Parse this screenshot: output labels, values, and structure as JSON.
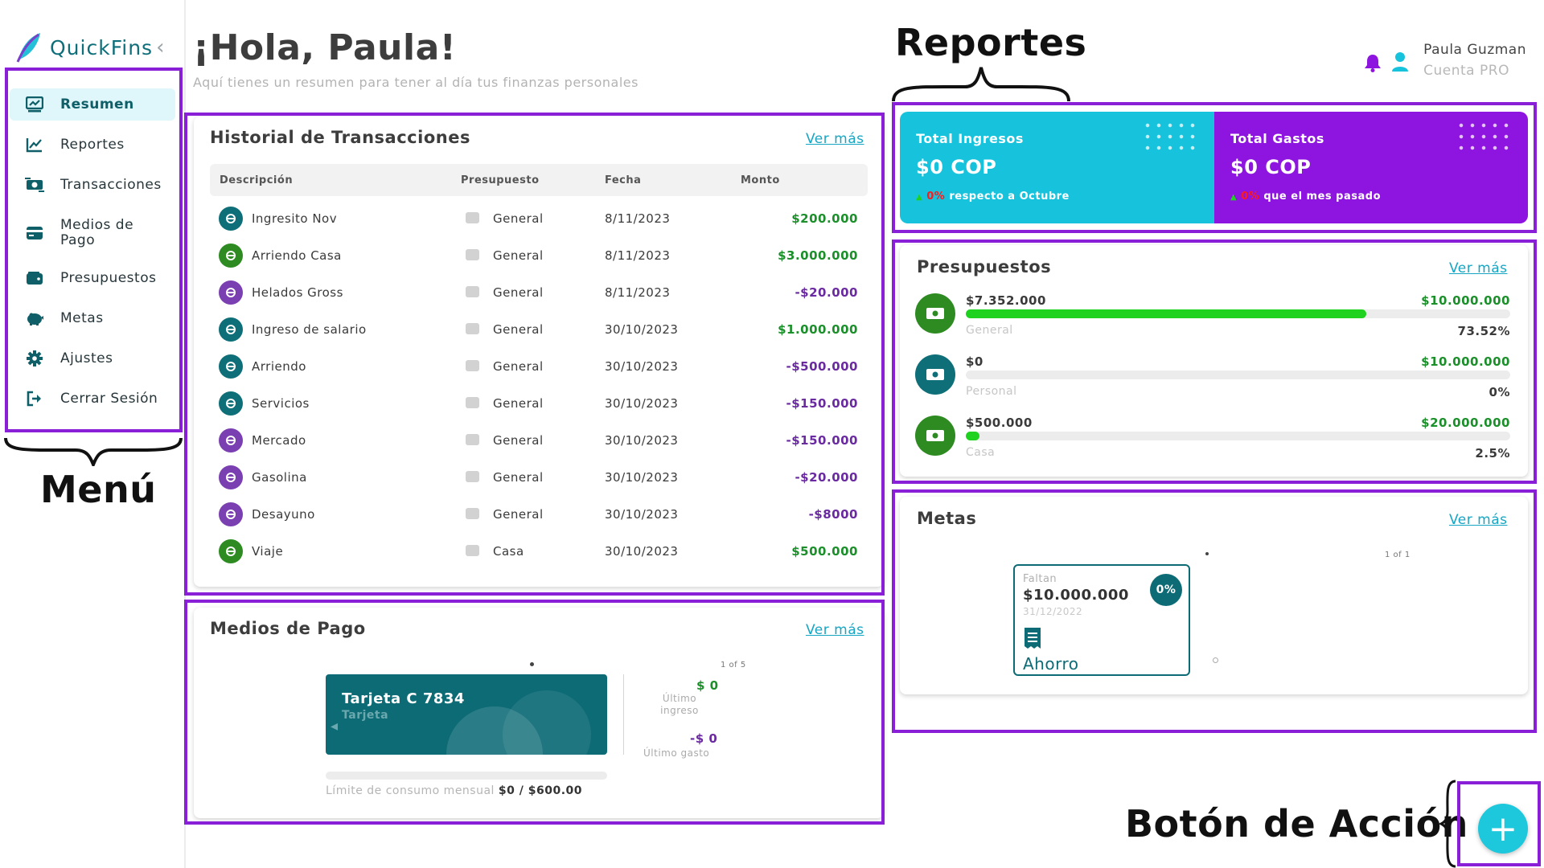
{
  "app": {
    "name": "QuickFins",
    "collapse_icon": "chevron-left-icon"
  },
  "menu": {
    "items": [
      {
        "label": "Resumen",
        "icon": "dashboard-icon",
        "active": true
      },
      {
        "label": "Reportes",
        "icon": "line-chart-icon"
      },
      {
        "label": "Transacciones",
        "icon": "money-transfer-icon"
      },
      {
        "label": "Medios de Pago",
        "icon": "credit-card-icon"
      },
      {
        "label": "Presupuestos",
        "icon": "wallet-icon"
      },
      {
        "label": "Metas",
        "icon": "piggy-bank-icon"
      },
      {
        "label": "Ajustes",
        "icon": "gear-icon"
      },
      {
        "label": "Cerrar Sesión",
        "icon": "logout-icon"
      }
    ]
  },
  "header": {
    "greeting": "¡Hola, Paula!",
    "subtitle": "Aquí tienes un resumen para tener al día tus finanzas personales",
    "user_name": "Paula Guzman",
    "user_plan": "Cuenta PRO"
  },
  "annotations": {
    "menu": "Menú",
    "reportes": "Reportes",
    "boton_accion": "Botón de Acción"
  },
  "transactions": {
    "title": "Historial de Transacciones",
    "more": "Ver más",
    "columns": [
      "Descripción",
      "Presupuesto",
      "Fecha",
      "Monto"
    ],
    "rows": [
      {
        "desc": "Ingresito Nov",
        "budget": "General",
        "date": "8/11/2023",
        "amount": "$200.000",
        "type": "pos",
        "icon": "transfer-icon",
        "color": "#0f6f78"
      },
      {
        "desc": "Arriendo Casa",
        "budget": "General",
        "date": "8/11/2023",
        "amount": "$3.000.000",
        "type": "pos",
        "icon": "house-income-icon",
        "color": "#2e8b22"
      },
      {
        "desc": "Helados Gross",
        "budget": "General",
        "date": "8/11/2023",
        "amount": "-$20.000",
        "type": "neg",
        "icon": "food-icon",
        "color": "#7a3fb0"
      },
      {
        "desc": "Ingreso de salario",
        "budget": "General",
        "date": "30/10/2023",
        "amount": "$1.000.000",
        "type": "pos",
        "icon": "cash-icon",
        "color": "#0f6f78"
      },
      {
        "desc": "Arriendo",
        "budget": "General",
        "date": "30/10/2023",
        "amount": "-$500.000",
        "type": "neg",
        "icon": "house-icon",
        "color": "#0f6f78"
      },
      {
        "desc": "Servicios",
        "budget": "General",
        "date": "30/10/2023",
        "amount": "-$150.000",
        "type": "neg",
        "icon": "receipt-icon",
        "color": "#0f6f78"
      },
      {
        "desc": "Mercado",
        "budget": "General",
        "date": "30/10/2023",
        "amount": "-$150.000",
        "type": "neg",
        "icon": "food-icon",
        "color": "#7a3fb0"
      },
      {
        "desc": "Gasolina",
        "budget": "General",
        "date": "30/10/2023",
        "amount": "-$20.000",
        "type": "neg",
        "icon": "bus-icon",
        "color": "#7a3fb0"
      },
      {
        "desc": "Desayuno",
        "budget": "General",
        "date": "30/10/2023",
        "amount": "-$8000",
        "type": "neg",
        "icon": "food-icon",
        "color": "#7a3fb0"
      },
      {
        "desc": "Viaje",
        "budget": "Casa",
        "date": "30/10/2023",
        "amount": "$500.000",
        "type": "pos",
        "icon": "plane-icon",
        "color": "#2e8b22"
      }
    ]
  },
  "payment": {
    "title": "Medios de Pago",
    "more": "Ver más",
    "pager": "1 of 5",
    "card_name": "Tarjeta C 7834",
    "card_type": "Tarjeta",
    "last_income_value": "$ 0",
    "last_income_label": "Último ingreso",
    "last_expense_value": "-$ 0",
    "last_expense_label": "Último gasto",
    "limit_label": "Límite de consumo mensual",
    "limit_value": "$0 / $600.00"
  },
  "reports": {
    "income_title": "Total Ingresos",
    "income_value": "$0 COP",
    "income_pct": "0%",
    "income_note": "respecto a Octubre",
    "expense_title": "Total Gastos",
    "expense_value": "$0 COP",
    "expense_pct": "0%",
    "expense_note": "que el mes pasado"
  },
  "budgets": {
    "title": "Presupuestos",
    "more": "Ver más",
    "items": [
      {
        "current": "$7.352.000",
        "total": "$10.000.000",
        "name": "General",
        "pct_label": "73.52%",
        "pct": 0.7352,
        "icon": "cash-icon",
        "color": "#2e8b22"
      },
      {
        "current": "$0",
        "total": "$10.000.000",
        "name": "Personal",
        "pct_label": "0%",
        "pct": 0,
        "icon": "money-growth-icon",
        "color": "#0f6f78"
      },
      {
        "current": "$500.000",
        "total": "$20.000.000",
        "name": "Casa",
        "pct_label": "2.5%",
        "pct": 0.025,
        "icon": "store-icon",
        "color": "#2e8b22"
      }
    ]
  },
  "goals": {
    "title": "Metas",
    "more": "Ver más",
    "pager": "1 of 1",
    "remaining_label": "Faltan",
    "amount": "$10.000.000",
    "date": "31/12/2022",
    "progress": "0%",
    "name": "Ahorro"
  },
  "fab": {
    "symbol": "+"
  },
  "colors": {
    "accent": "#16a6c4",
    "highlight": "#8a1fd8",
    "income_card": "#17c3dc",
    "expense_card": "#8e14e0",
    "positive": "#1b8f2a",
    "negative": "#6a2aa0"
  }
}
